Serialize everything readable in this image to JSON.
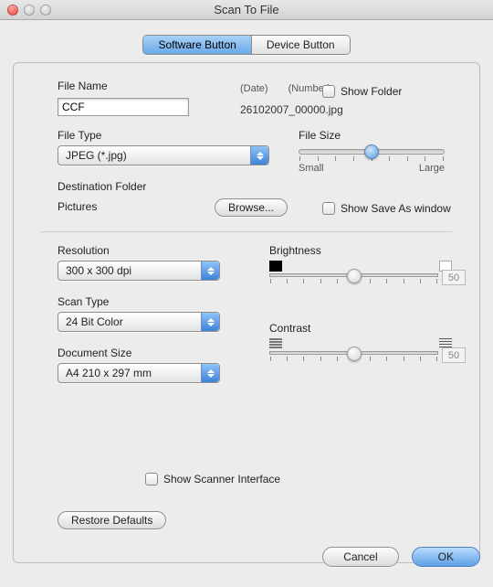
{
  "window": {
    "title": "Scan To File"
  },
  "tabs": {
    "software": "Software Button",
    "device": "Device Button"
  },
  "filename": {
    "label": "File Name",
    "value": "CCF",
    "date_label": "(Date)",
    "number_label": "(Number)",
    "example": "26102007_00000.jpg",
    "show_folder": "Show Folder"
  },
  "filetype": {
    "label": "File Type",
    "value": "JPEG (*.jpg)"
  },
  "filesize": {
    "label": "File Size",
    "small": "Small",
    "large": "Large"
  },
  "dest": {
    "label": "Destination Folder",
    "path": "Pictures",
    "browse": "Browse...",
    "show_saveas": "Show Save As window"
  },
  "resolution": {
    "label": "Resolution",
    "value": "300 x 300 dpi"
  },
  "scantype": {
    "label": "Scan Type",
    "value": "24 Bit Color"
  },
  "docsize": {
    "label": "Document Size",
    "value": "A4  210 x 297 mm"
  },
  "brightness": {
    "label": "Brightness",
    "value": "50"
  },
  "contrast": {
    "label": "Contrast",
    "value": "50"
  },
  "scanner_iface": "Show Scanner Interface",
  "buttons": {
    "restore": "Restore Defaults",
    "cancel": "Cancel",
    "ok": "OK"
  }
}
